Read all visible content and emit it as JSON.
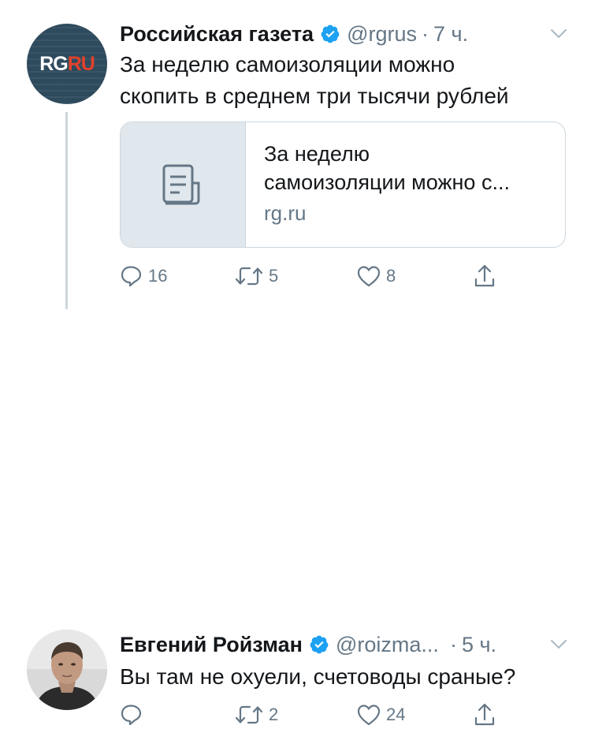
{
  "tweets": [
    {
      "author": "Российская газета",
      "handle": "@rgrus",
      "separator": "·",
      "time": "7 ч.",
      "avatar_logo": {
        "rg": "RG",
        "ru": "RU"
      },
      "text_lines": [
        "За неделю самоизоляции можно",
        "скопить в среднем три тысячи рублей"
      ],
      "card": {
        "title_lines": [
          "За неделю",
          "самоизоляции можно с..."
        ],
        "domain": "rg.ru",
        "thumb_icon": "document-icon"
      },
      "actions": {
        "replies": "16",
        "retweets": "5",
        "likes": "8"
      }
    },
    {
      "author": "Евгений Ройзман",
      "handle": "@roizma...",
      "separator": "·",
      "time": "5 ч.",
      "text_lines": [
        "Вы там не охуели, счетоводы сраные?"
      ],
      "actions": {
        "replies": "",
        "retweets": "2",
        "likes": "24"
      }
    }
  ],
  "colors": {
    "text": "#14171a",
    "secondary": "#657786",
    "verified": "#1da1f2",
    "border": "#ccd6dd",
    "card_thumb_bg": "#e1e8ed"
  },
  "icons": [
    "verified-badge-icon",
    "chevron-down-icon",
    "reply-icon",
    "retweet-icon",
    "like-icon",
    "share-icon",
    "document-icon"
  ]
}
